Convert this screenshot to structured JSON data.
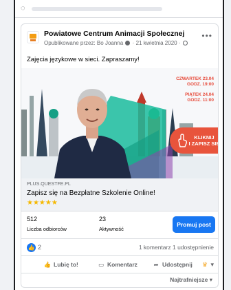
{
  "post": {
    "page_name": "Powiatowe Centrum Animacji Społecznej",
    "meta_prefix": "Opublikowane przez: Bo Joanna",
    "meta_date": "21 kwietnia 2020",
    "text": "Zajęcia  językowe w sieci. Zapraszamy!",
    "more_label": "•••"
  },
  "banner": {
    "schedule": [
      "CZWARTEK 23.04",
      "GODZ. 19:00",
      "PIĄTEK 24.04",
      "GODZ. 11:00"
    ],
    "cta_lines": [
      "KLIKNIJ",
      "I ZAPISZ SIĘ"
    ],
    "accent_color": "#e8543c",
    "teal_color": "#1abc9c"
  },
  "link": {
    "domain": "PLUS.QUESTFE.PL",
    "title": "Zapisz się na Bezpłatne Szkolenie Online!",
    "stars": "★★★★★"
  },
  "stats": {
    "reach_value": "512",
    "reach_label": "Liczba odbiorców",
    "engagement_value": "23",
    "engagement_label": "Aktywność",
    "promote_label": "Promuj post"
  },
  "social": {
    "likes": "2",
    "comments_shares": "1 komentarz  1 udostępnienie"
  },
  "actions": {
    "like": "Lubię to!",
    "comment": "Komentarz",
    "share": "Udostępnij",
    "react_caret": "▾"
  },
  "sort_label": "Najtrafniejsze ▾",
  "colors": {
    "brand_blue": "#1877f2",
    "star_color": "#f5b800"
  }
}
